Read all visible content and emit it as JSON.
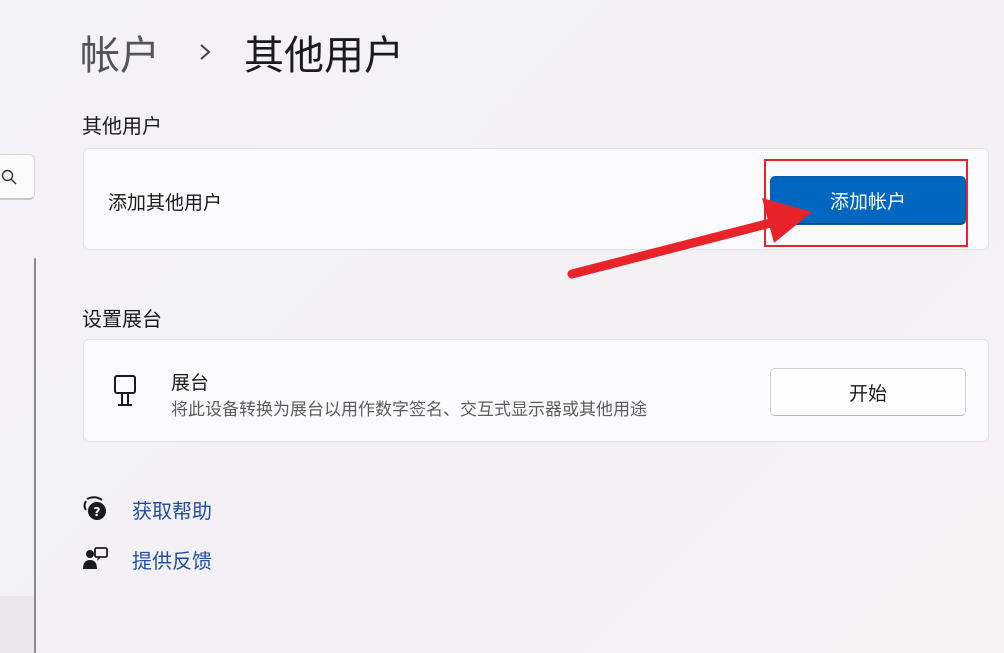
{
  "breadcrumb": {
    "parent": "帐户",
    "current": "其他用户"
  },
  "sections": {
    "other_users": {
      "title": "其他用户",
      "add_label": "添加其他用户",
      "add_button": "添加帐户"
    },
    "kiosk": {
      "title": "设置展台",
      "item_title": "展台",
      "item_desc": "将此设备转换为展台以用作数字签名、交互式显示器或其他用途",
      "button": "开始"
    }
  },
  "links": {
    "help": "获取帮助",
    "feedback": "提供反馈"
  },
  "icons": {
    "search": "search-icon",
    "chevron": "chevron-right-icon",
    "kiosk": "kiosk-icon",
    "help": "help-icon",
    "feedback": "feedback-icon"
  },
  "colors": {
    "accent": "#0067c0",
    "annotation": "#e8242a",
    "link": "#1f4fa3"
  }
}
